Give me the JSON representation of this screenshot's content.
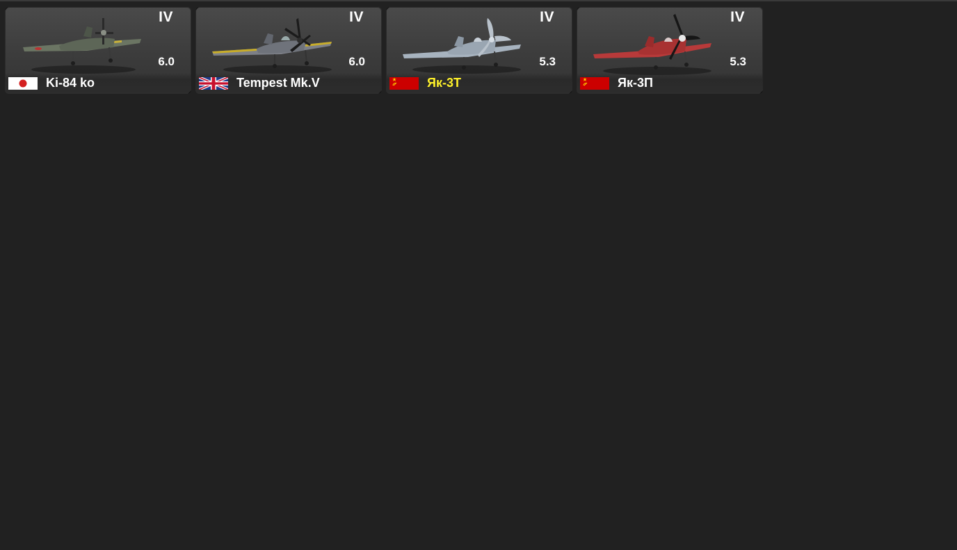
{
  "colors": {
    "background": "#212121",
    "card_background": "#3c3c3c",
    "text": "#ffffff",
    "highlight_name": "#fff22a"
  },
  "vehicles": [
    {
      "rank": "IV",
      "battle_rating": "6.0",
      "name": "Ki-84 ko",
      "nation": "Japan",
      "flag_icon": "japan-flag-icon",
      "camouflage": "green with yellow wing stripes",
      "highlighted": false
    },
    {
      "rank": "IV",
      "battle_rating": "6.0",
      "name": "Tempest Mk.V",
      "nation": "Great Britain",
      "flag_icon": "uk-flag-icon",
      "camouflage": "grey with yellow wing stripes",
      "highlighted": false
    },
    {
      "rank": "IV",
      "battle_rating": "5.3",
      "name": "Як-3Т",
      "nation": "USSR",
      "flag_icon": "ussr-flag-icon",
      "camouflage": "light blue-grey",
      "highlighted": true
    },
    {
      "rank": "IV",
      "battle_rating": "5.3",
      "name": "Як-3П",
      "nation": "USSR",
      "flag_icon": "ussr-flag-icon",
      "camouflage": "red",
      "highlighted": false
    }
  ]
}
